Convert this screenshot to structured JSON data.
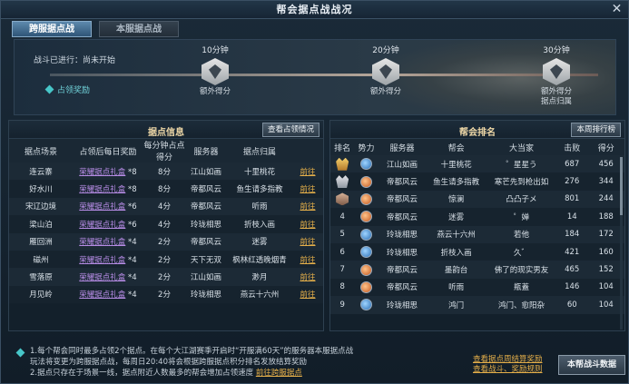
{
  "window": {
    "title": "帮会据点战战况"
  },
  "tabs": [
    {
      "label": "跨服据点战",
      "active": true
    },
    {
      "label": "本服据点战",
      "active": false
    }
  ],
  "battle": {
    "status": "战斗已进行：尚未开始",
    "reward_link": "占领奖励",
    "checkpoints": [
      {
        "time": "10分钟",
        "desc": [
          "额外得分"
        ]
      },
      {
        "time": "20分钟",
        "desc": [
          "额外得分"
        ]
      },
      {
        "time": "30分钟",
        "desc": [
          "额外得分",
          "据点归属"
        ]
      }
    ]
  },
  "stronghold": {
    "title": "据点信息",
    "button": "查看占领情况",
    "headers": [
      "据点场景",
      "占领后每日奖励",
      "每分钟占点得分",
      "服务器",
      "据点归属",
      ""
    ],
    "rows": [
      {
        "scene": "连云寨",
        "reward": "荣耀据点礼盒",
        "qty": "*8",
        "score": "8分",
        "server": "江山如画",
        "owner": "十里桃花",
        "action": "前往"
      },
      {
        "scene": "好水川",
        "reward": "荣耀据点礼盒",
        "qty": "*8",
        "score": "8分",
        "server": "帝都风云",
        "owner": "鱼生请多指教",
        "action": "前往"
      },
      {
        "scene": "宋辽边境",
        "reward": "荣耀据点礼盒",
        "qty": "*6",
        "score": "4分",
        "server": "帝都风云",
        "owner": "听雨",
        "action": "前往"
      },
      {
        "scene": "梁山泊",
        "reward": "荣耀据点礼盒",
        "qty": "*6",
        "score": "4分",
        "server": "玲珑相思",
        "owner": "折枝入画",
        "action": "前往"
      },
      {
        "scene": "雁回洲",
        "reward": "荣耀据点礼盒",
        "qty": "*4",
        "score": "2分",
        "server": "帝都风云",
        "owner": "迷雾",
        "action": "前往"
      },
      {
        "scene": "磁州",
        "reward": "荣耀据点礼盒",
        "qty": "*4",
        "score": "2分",
        "server": "天下无双",
        "owner": "枫林红透晚烟青",
        "action": "前往"
      },
      {
        "scene": "雪落原",
        "reward": "荣耀据点礼盒",
        "qty": "*4",
        "score": "2分",
        "server": "江山如画",
        "owner": "渺月",
        "action": "前往"
      },
      {
        "scene": "月见岭",
        "reward": "荣耀据点礼盒",
        "qty": "*4",
        "score": "2分",
        "server": "玲珑相思",
        "owner": "燕云十六州",
        "action": "前往"
      }
    ]
  },
  "ranking": {
    "title": "帮会排名",
    "button": "本周排行榜",
    "headers": [
      "排名",
      "势力",
      "服务器",
      "帮会",
      "大当家",
      "击败",
      "得分"
    ],
    "rows": [
      {
        "rank": "1",
        "badge": "gold",
        "faction": "blue",
        "server": "江山如画",
        "guild": "十里桃花",
        "leader": "゜星星う",
        "kills": "687",
        "score": "456"
      },
      {
        "rank": "2",
        "badge": "silver",
        "faction": "orange",
        "server": "帝都风云",
        "guild": "鱼生请多指教",
        "leader": "寒芒先到枪出如",
        "kills": "276",
        "score": "344"
      },
      {
        "rank": "3",
        "badge": "bronze",
        "faction": "orange",
        "server": "帝都风云",
        "guild": "惊澜",
        "leader": "凸凸子メ",
        "kills": "801",
        "score": "244"
      },
      {
        "rank": "4",
        "badge": "",
        "faction": "orange",
        "server": "帝都风云",
        "guild": "迷雾",
        "leader": "゜婵",
        "kills": "14",
        "score": "188"
      },
      {
        "rank": "5",
        "badge": "",
        "faction": "blue",
        "server": "玲珑相思",
        "guild": "燕云十六州",
        "leader": "若他",
        "kills": "184",
        "score": "172"
      },
      {
        "rank": "6",
        "badge": "",
        "faction": "blue",
        "server": "玲珑相思",
        "guild": "折枝入画",
        "leader": "久゛",
        "kills": "421",
        "score": "160"
      },
      {
        "rank": "7",
        "badge": "",
        "faction": "orange",
        "server": "帝都风云",
        "guild": "墨韵台",
        "leader": "佛了的现实男友",
        "kills": "465",
        "score": "152"
      },
      {
        "rank": "8",
        "badge": "",
        "faction": "orange",
        "server": "帝都风云",
        "guild": "听雨",
        "leader": "瓶蓋",
        "kills": "146",
        "score": "104"
      },
      {
        "rank": "9",
        "badge": "",
        "faction": "blue",
        "server": "玲珑相思",
        "guild": "鸿门",
        "leader": "鸿门、愈阳杂",
        "kills": "60",
        "score": "104"
      }
    ]
  },
  "footer": {
    "note1": "1.每个帮会同时最多占领2个据点。在每个大江湖赛季开启时“开服满60天”的服务器本服据点战",
    "note2": "玩法将变更为跨服据点战，每周日20:40将会根据跨服据点积分排名发放结算奖励",
    "note3_prefix": "2.据点只存在于场景一线，据点附近人数最多的帮会增加占领速度",
    "note3_link": "前往跨服据点",
    "link_weekly": "查看据点周结算奖励",
    "link_rules": "查看战斗、奖励规则",
    "stats_button": "本帮战斗数据"
  }
}
